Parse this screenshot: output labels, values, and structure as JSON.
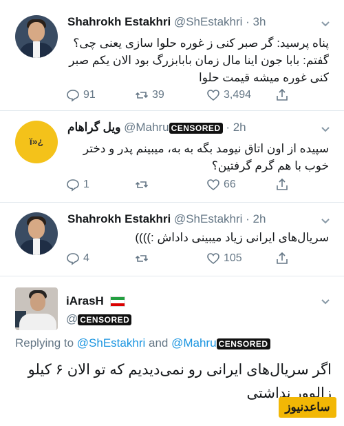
{
  "tweets": [
    {
      "name": "Shahrokh Estakhri",
      "handle": "@ShEstakhri",
      "time": "· 3h",
      "text": "پناه پرسید: گر صبر کنی ز غوره حلوا سازی یعنی چی؟\nگفتم: بابا جون اینا مال زمان بابابزرگ بود الان یکم صبر کنی غوره میشه قیمت حلوا",
      "replies": "91",
      "retweets": "39",
      "likes": "3,494"
    },
    {
      "name": "ویل گراهام",
      "handle": "@Mahru",
      "censor": "CENSORED",
      "time": "· 2h",
      "avatar_glyph": "ï»¿",
      "text": "سپیده از اون اتاق نیومد بگه به به، میبینم پدر و دختر خوب با هم گرم گرفتین؟",
      "replies": "1",
      "retweets": "",
      "likes": "66"
    },
    {
      "name": "Shahrokh Estakhri",
      "handle": "@ShEstakhri",
      "time": "· 2h",
      "text": "سریال‌های ایرانی زیاد میبینی داداش :))))",
      "replies": "4",
      "retweets": "",
      "likes": "105"
    }
  ],
  "reply_tweet": {
    "name": "iArasH",
    "handle": "@",
    "censor": "CENSORED",
    "replying_prefix": "Replying to",
    "replying_user1": "@ShEstakhri",
    "replying_and": "and",
    "replying_user2": "@Mahru",
    "text": "اگر سریال‌های ایرانی رو نمی‌دیدیم که تو الان ۶ کیلو زالوور نداشتی"
  },
  "watermark": "ساعدنیوز",
  "colors": {
    "text": "#14171a",
    "muted": "#657786",
    "link": "#1b95e0",
    "separator": "#e1e8ed",
    "watermark_bg": "#f2b705"
  }
}
